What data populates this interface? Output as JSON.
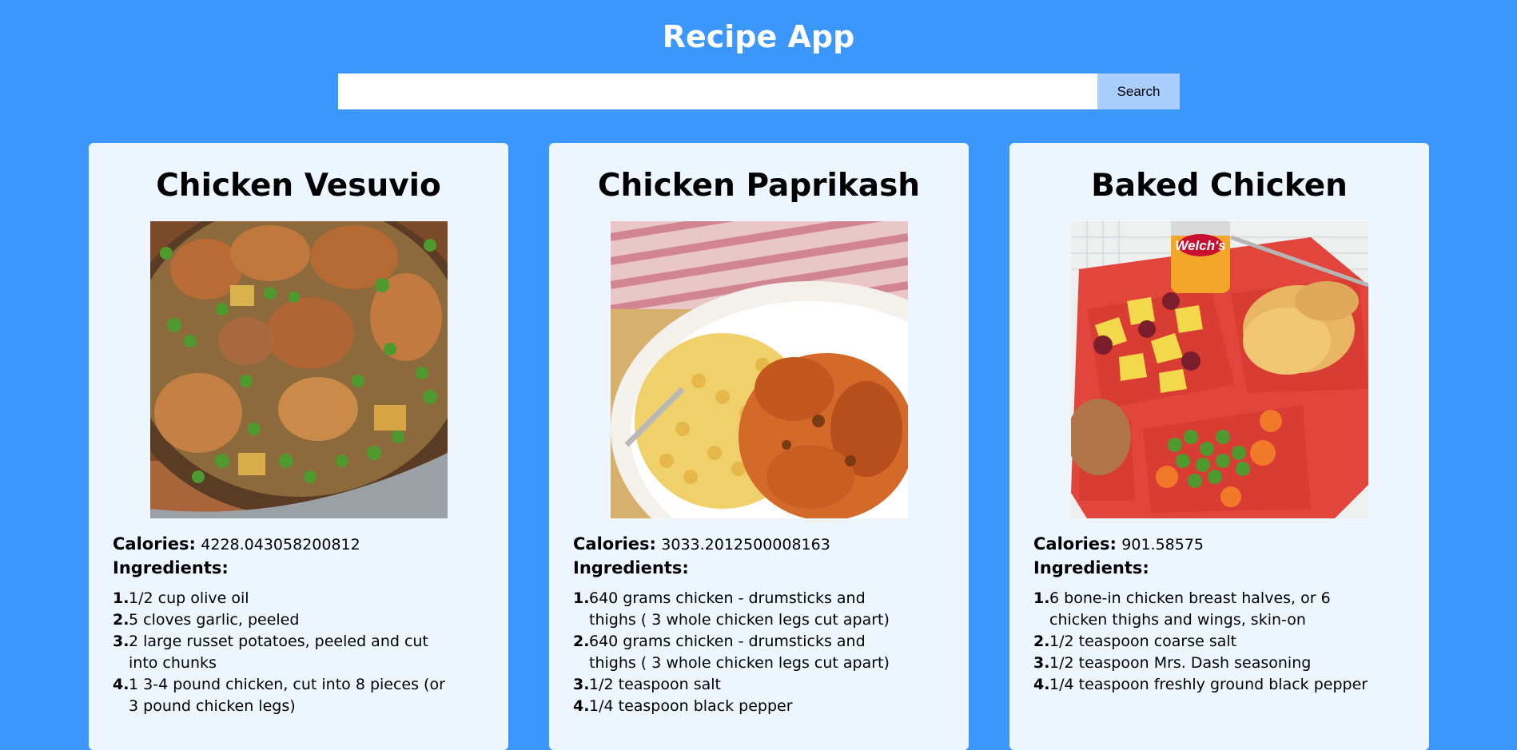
{
  "app": {
    "title": "Recipe App"
  },
  "colors": {
    "background": "#3c97fc",
    "card": "#edf6ff",
    "search_button": "#a9cdfc"
  },
  "search": {
    "value": "",
    "placeholder": "",
    "button_label": "Search"
  },
  "labels": {
    "calories": "Calories:",
    "ingredients": "Ingredients:"
  },
  "recipes": [
    {
      "title": "Chicken Vesuvio",
      "image": "chicken-vesuvio-photo",
      "calories": "4228.043058200812",
      "ingredients": [
        {
          "num": "1.",
          "text": "1/2 cup olive oil"
        },
        {
          "num": "2.",
          "text": "5 cloves garlic, peeled"
        },
        {
          "num": "3.",
          "text": "2 large russet potatoes, peeled and cut into chunks"
        },
        {
          "num": "4.",
          "text": "1 3-4 pound chicken, cut into 8 pieces (or 3 pound chicken legs)"
        }
      ]
    },
    {
      "title": "Chicken Paprikash",
      "image": "chicken-paprikash-photo",
      "calories": "3033.2012500008163",
      "ingredients": [
        {
          "num": "1.",
          "text": "640 grams chicken - drumsticks and thighs ( 3 whole chicken legs cut apart)"
        },
        {
          "num": "2.",
          "text": "640 grams chicken - drumsticks and thighs ( 3 whole chicken legs cut apart)"
        },
        {
          "num": "3.",
          "text": "1/2 teaspoon salt"
        },
        {
          "num": "4.",
          "text": "1/4 teaspoon black pepper"
        }
      ]
    },
    {
      "title": "Baked Chicken",
      "image": "baked-chicken-photo",
      "calories": "901.58575",
      "ingredients": [
        {
          "num": "1.",
          "text": "6 bone-in chicken breast halves, or 6 chicken thighs and wings, skin-on"
        },
        {
          "num": "2.",
          "text": "1/2 teaspoon coarse salt"
        },
        {
          "num": "3.",
          "text": "1/2 teaspoon Mrs. Dash seasoning"
        },
        {
          "num": "4.",
          "text": "1/4 teaspoon freshly ground black pepper"
        }
      ]
    }
  ]
}
